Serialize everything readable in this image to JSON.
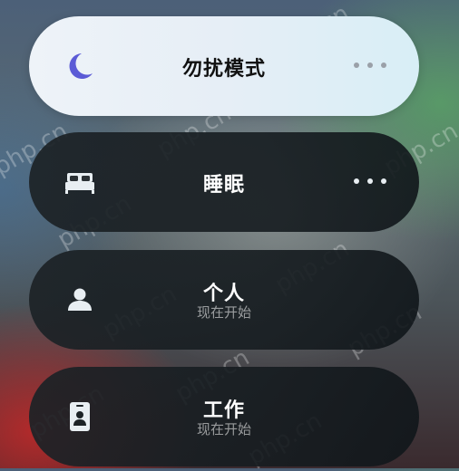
{
  "focus_modes": [
    {
      "label": "勿扰模式",
      "subtitle": "",
      "icon": "moon-icon",
      "active": true,
      "has_more": true
    },
    {
      "label": "睡眠",
      "subtitle": "",
      "icon": "bed-icon",
      "active": false,
      "has_more": true
    },
    {
      "label": "个人",
      "subtitle": "现在开始",
      "icon": "person-icon",
      "active": false,
      "has_more": false
    },
    {
      "label": "工作",
      "subtitle": "现在开始",
      "icon": "id-badge-icon",
      "active": false,
      "has_more": false
    }
  ],
  "watermark": "php.cn",
  "colors": {
    "moon": "#5b5bd6",
    "active_bg": "#e8f0f8",
    "inactive_bg": "#1c2226"
  }
}
